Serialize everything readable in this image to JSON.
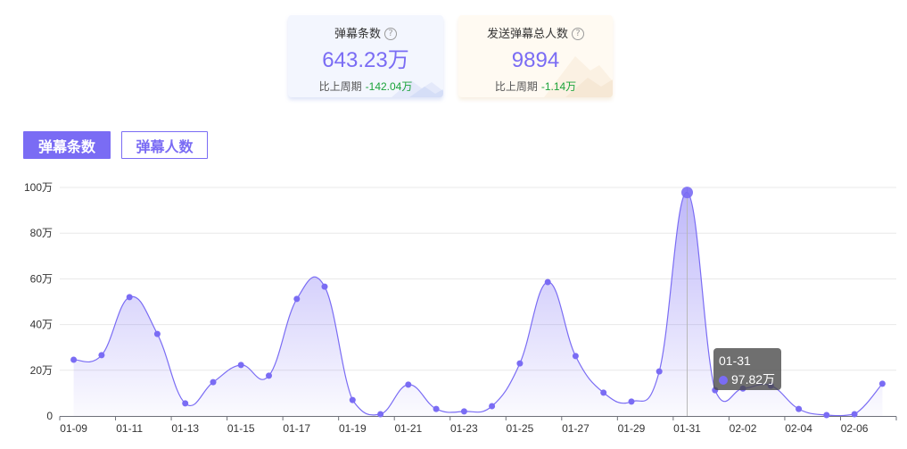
{
  "stats": [
    {
      "title": "弹幕条数",
      "value": "643.23万",
      "compare_label": "比上周期",
      "compare_value": "-142.04万"
    },
    {
      "title": "发送弹幕总人数",
      "value": "9894",
      "compare_label": "比上周期",
      "compare_value": "-1.14万"
    }
  ],
  "tabs": [
    {
      "label": "弹幕条数",
      "active": true
    },
    {
      "label": "弹幕人数",
      "active": false
    }
  ],
  "tooltip": {
    "date": "01-31",
    "value": "97.82万"
  },
  "icons": {
    "help": "question-circle-icon"
  },
  "colors": {
    "accent": "#7a6cf4",
    "change": "#1aa33a",
    "card_blue": "#f3f6fe",
    "card_cream": "#fffaf2"
  },
  "chart_data": {
    "type": "area",
    "smooth": true,
    "categories": [
      "01-09",
      "01-10",
      "01-11",
      "01-12",
      "01-13",
      "01-14",
      "01-15",
      "01-16",
      "01-17",
      "01-18",
      "01-19",
      "01-20",
      "01-21",
      "01-22",
      "01-23",
      "01-24",
      "01-25",
      "01-26",
      "01-27",
      "01-28",
      "01-29",
      "01-30",
      "01-31",
      "02-01",
      "02-02",
      "02-03",
      "02-04",
      "02-05",
      "02-06",
      "02-07"
    ],
    "series": [
      {
        "values": [
          24.6,
          26.6,
          52.0,
          35.9,
          5.5,
          14.8,
          22.3,
          17.6,
          51.2,
          56.6,
          7.0,
          0.8,
          13.7,
          3.1,
          2.0,
          4.3,
          23.0,
          58.6,
          26.2,
          10.2,
          6.3,
          19.5,
          97.82,
          11.3,
          12.0,
          13.3,
          3.1,
          0.4,
          0.8,
          14.1
        ]
      }
    ],
    "y_tick_labels": [
      "0",
      "20万",
      "40万",
      "60万",
      "80万",
      "100万"
    ],
    "ylim": [
      0,
      100
    ],
    "grid": true
  }
}
